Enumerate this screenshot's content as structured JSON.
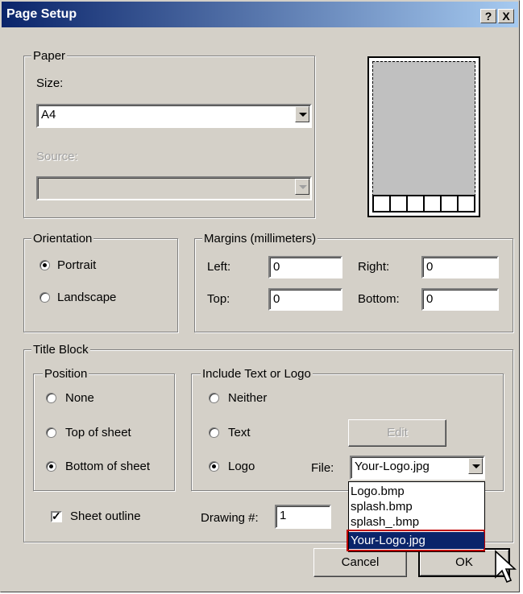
{
  "window": {
    "title": "Page Setup",
    "help_button": "?",
    "close_button": "X"
  },
  "paper": {
    "legend": "Paper",
    "size_label": "Size:",
    "size_value": "A4",
    "source_label": "Source:",
    "source_value": ""
  },
  "orientation": {
    "legend": "Orientation",
    "portrait": "Portrait",
    "landscape": "Landscape",
    "selected": "Portrait"
  },
  "margins": {
    "legend": "Margins (millimeters)",
    "left_label": "Left:",
    "left_value": "0",
    "right_label": "Right:",
    "right_value": "0",
    "top_label": "Top:",
    "top_value": "0",
    "bottom_label": "Bottom:",
    "bottom_value": "0"
  },
  "title_block": {
    "legend": "Title Block",
    "position": {
      "legend": "Position",
      "none": "None",
      "top": "Top of sheet",
      "bottom": "Bottom of sheet",
      "selected": "Bottom of sheet"
    },
    "include": {
      "legend": "Include Text or Logo",
      "neither": "Neither",
      "text": "Text",
      "logo": "Logo",
      "selected": "Logo",
      "edit_button": "Edit",
      "file_label": "File:",
      "file_value": "Your-Logo.jpg",
      "file_options": [
        "Logo.bmp",
        "splash.bmp",
        "splash_.bmp",
        "Your-Logo.jpg"
      ]
    },
    "sheet_outline": "Sheet outline",
    "sheet_outline_checked": true,
    "drawing_label": "Drawing #:",
    "drawing_value": "1"
  },
  "buttons": {
    "cancel": "Cancel",
    "ok": "OK"
  }
}
